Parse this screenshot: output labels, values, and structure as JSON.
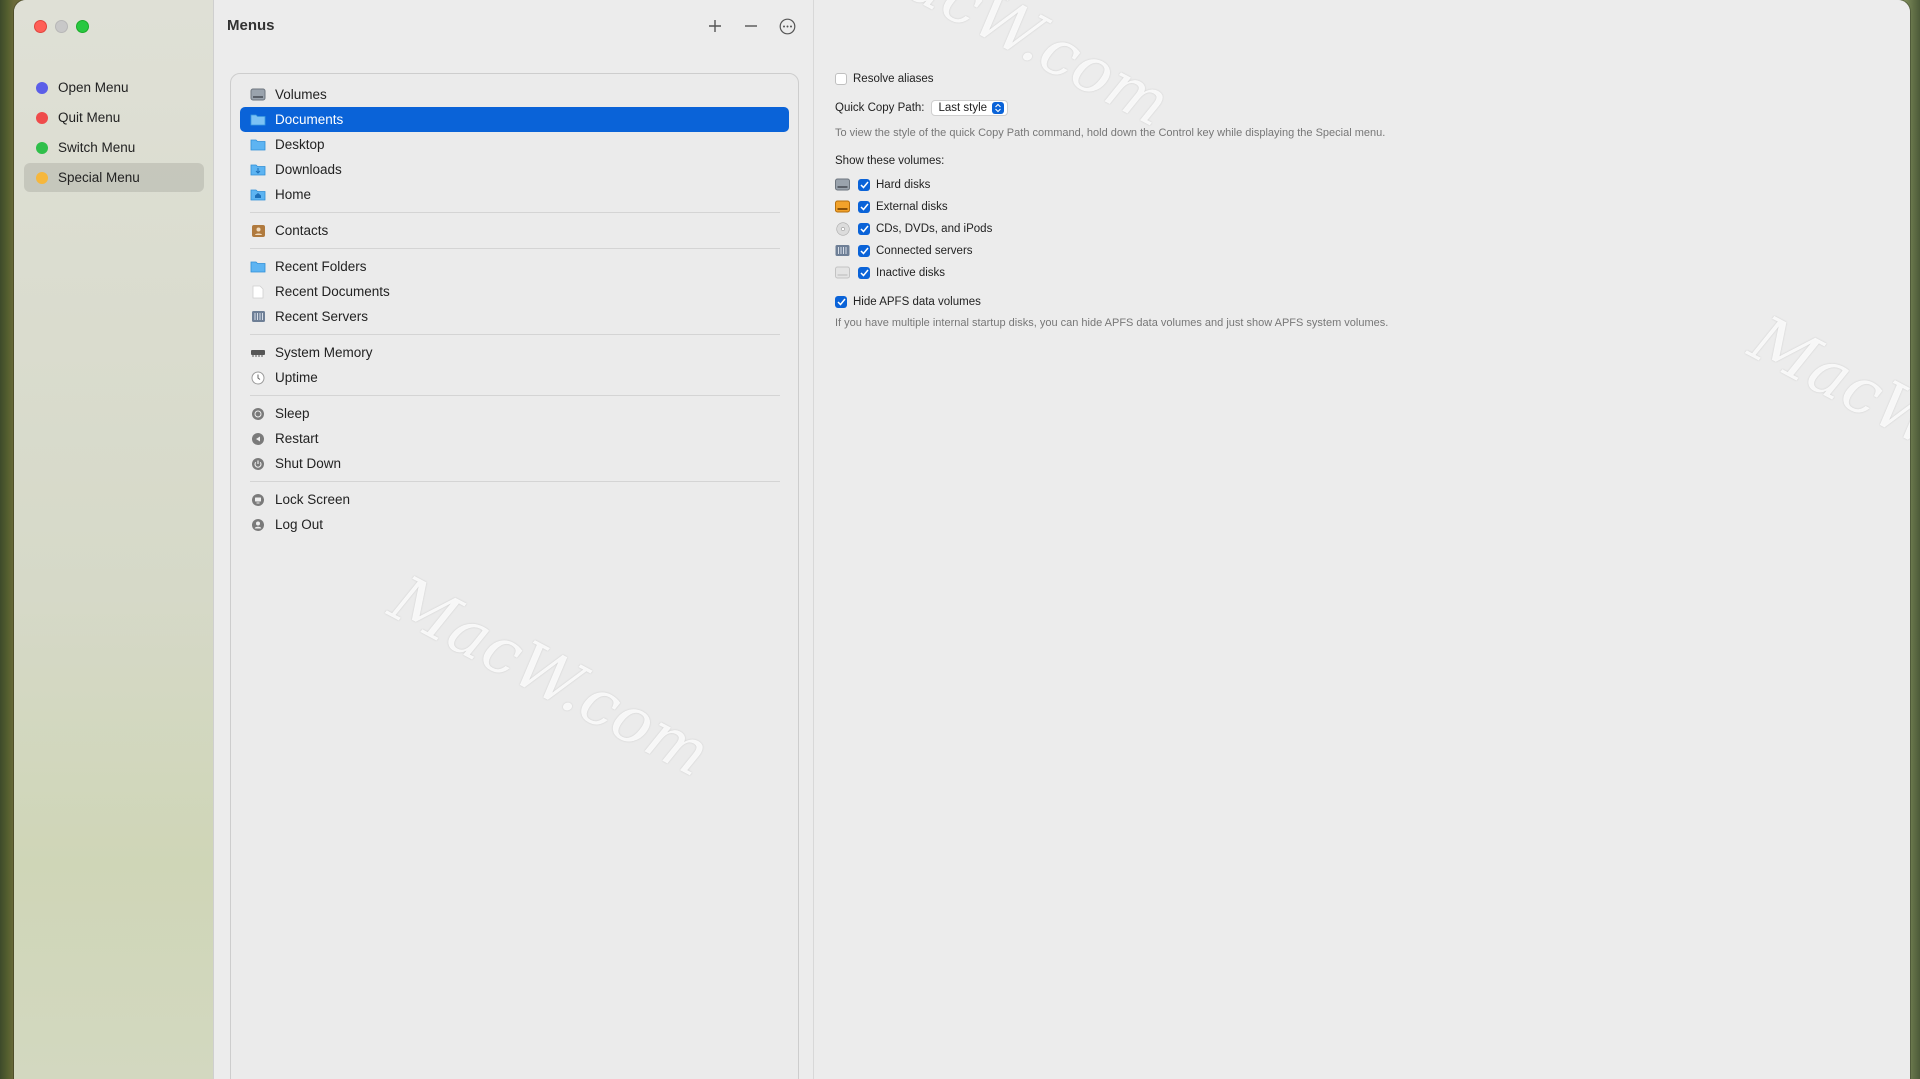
{
  "sidebar": {
    "items": [
      {
        "label": "Open Menu",
        "color": "#5b5ee8"
      },
      {
        "label": "Quit Menu",
        "color": "#ef4b4b"
      },
      {
        "label": "Switch Menu",
        "color": "#2fbf4a"
      },
      {
        "label": "Special Menu",
        "color": "#f6b73c",
        "active": true
      }
    ]
  },
  "middle": {
    "title": "Menus",
    "items": [
      {
        "label": "Volumes",
        "icon": "hard-disk-icon"
      },
      {
        "label": "Documents",
        "icon": "folder-icon",
        "selected": true
      },
      {
        "label": "Desktop",
        "icon": "folder-icon"
      },
      {
        "label": "Downloads",
        "icon": "downloads-folder-icon"
      },
      {
        "label": "Home",
        "icon": "home-folder-icon"
      },
      {
        "label": "Contacts",
        "icon": "contacts-icon"
      },
      {
        "label": "Recent Folders",
        "icon": "folder-icon"
      },
      {
        "label": "Recent Documents",
        "icon": "document-icon"
      },
      {
        "label": "Recent Servers",
        "icon": "server-icon"
      },
      {
        "label": "System Memory",
        "icon": "memory-icon"
      },
      {
        "label": "Uptime",
        "icon": "clock-icon"
      },
      {
        "label": "Sleep",
        "icon": "sleep-icon"
      },
      {
        "label": "Restart",
        "icon": "restart-icon"
      },
      {
        "label": "Shut Down",
        "icon": "power-icon"
      },
      {
        "label": "Lock Screen",
        "icon": "lock-screen-icon"
      },
      {
        "label": "Log Out",
        "icon": "user-icon"
      }
    ]
  },
  "right": {
    "resolve_aliases": {
      "label": "Resolve aliases",
      "checked": false
    },
    "quick_copy_label": "Quick Copy Path:",
    "quick_copy_value": "Last style",
    "quick_copy_note": "To view the style of the quick Copy Path command, hold down the Control key while displaying the Special menu.",
    "show_volumes_label": "Show these volumes:",
    "volumes": [
      {
        "label": "Hard disks",
        "checked": true,
        "icon": "hard-disk-icon"
      },
      {
        "label": "External disks",
        "checked": true,
        "icon": "external-disk-icon"
      },
      {
        "label": "CDs, DVDs, and iPods",
        "checked": true,
        "icon": "cd-icon"
      },
      {
        "label": "Connected servers",
        "checked": true,
        "icon": "server-icon"
      },
      {
        "label": "Inactive disks",
        "checked": true,
        "icon": "inactive-disk-icon"
      }
    ],
    "hide_apfs": {
      "label": "Hide APFS data volumes",
      "checked": true
    },
    "hide_apfs_note": "If you have multiple internal startup disks, you can hide APFS data volumes and just show APFS system volumes."
  },
  "watermark": "MacW.com"
}
